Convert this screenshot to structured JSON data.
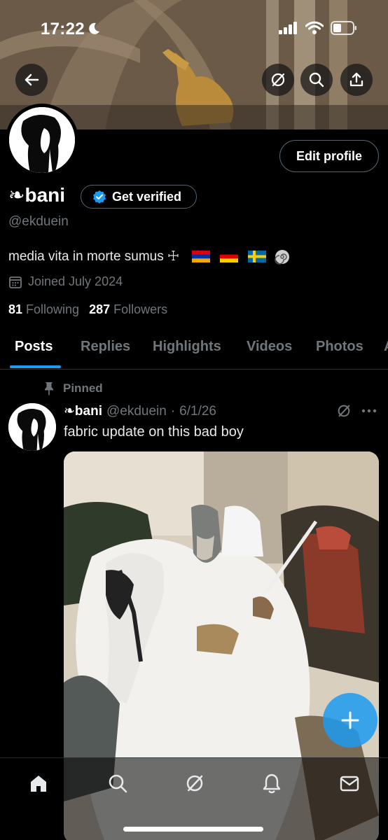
{
  "status_bar": {
    "time": "17:22"
  },
  "profile": {
    "display_name": "❧bani",
    "handle": "@ekduein",
    "edit_label": "Edit profile",
    "verify_label": "Get verified",
    "bio": "media vita in morte sumus ☩",
    "joined": "Joined July 2024",
    "following_count": "81",
    "following_label": "Following",
    "followers_count": "287",
    "followers_label": "Followers"
  },
  "tabs": [
    "Posts",
    "Replies",
    "Highlights",
    "Videos",
    "Photos",
    "A"
  ],
  "pinned_post": {
    "pinned_label": "Pinned",
    "author": "❧bani",
    "handle": "@ekduein",
    "separator": "·",
    "date": "6/1/26",
    "text": "fabric update on this bad boy"
  },
  "colors": {
    "accent": "#1d9bf0",
    "background": "#000000",
    "muted": "#71767b"
  },
  "icons": [
    "back-arrow-icon",
    "grok-icon",
    "search-icon",
    "share-icon",
    "verified-badge-icon",
    "calendar-icon",
    "pin-icon",
    "more-icon",
    "plus-icon",
    "home-icon",
    "bell-icon",
    "mail-icon"
  ]
}
